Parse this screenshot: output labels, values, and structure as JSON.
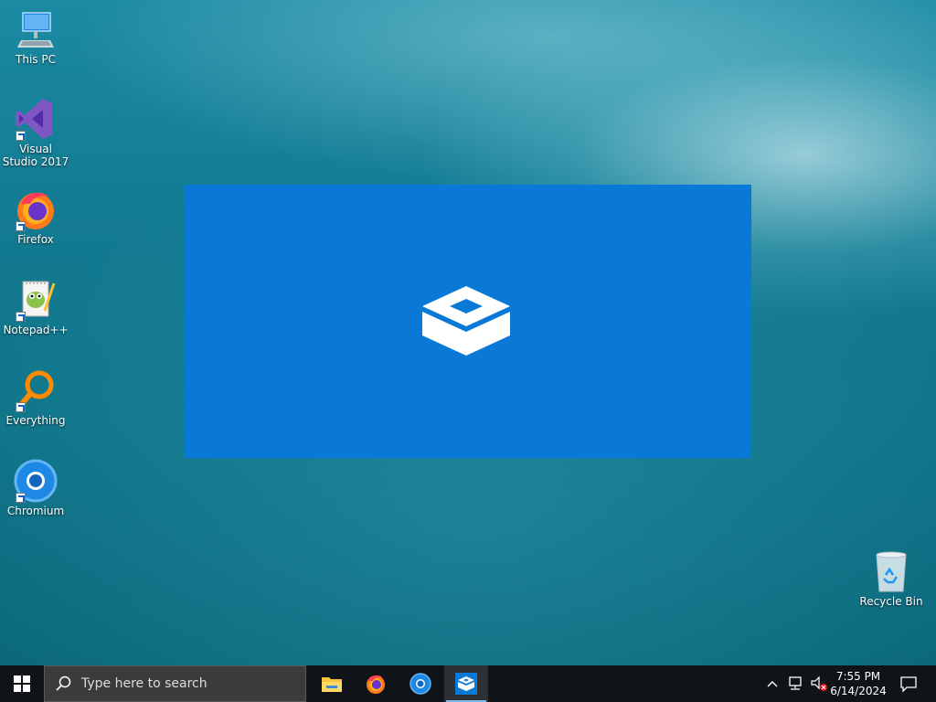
{
  "desktop": {
    "icons": [
      {
        "label": "This PC",
        "icon": "this-pc-icon"
      },
      {
        "label": "Visual Studio 2017",
        "icon": "visual-studio-icon"
      },
      {
        "label": "Firefox",
        "icon": "firefox-icon"
      },
      {
        "label": "Notepad++",
        "icon": "notepadpp-icon"
      },
      {
        "label": "Everything",
        "icon": "everything-icon"
      },
      {
        "label": "Chromium",
        "icon": "chromium-icon"
      },
      {
        "label": "Recycle Bin",
        "icon": "recycle-bin-icon"
      }
    ]
  },
  "splash": {
    "icon": "sandbox-icon",
    "background": "#0a78d7"
  },
  "taskbar": {
    "search_placeholder": "Type here to search",
    "apps": [
      {
        "name": "File Explorer",
        "icon": "file-explorer-icon"
      },
      {
        "name": "Firefox",
        "icon": "firefox-icon"
      },
      {
        "name": "Chromium",
        "icon": "chromium-icon"
      },
      {
        "name": "Windows Sandbox",
        "icon": "sandbox-icon",
        "active": true
      }
    ],
    "tray": {
      "time": "7:55 PM",
      "date": "6/14/2024"
    }
  }
}
